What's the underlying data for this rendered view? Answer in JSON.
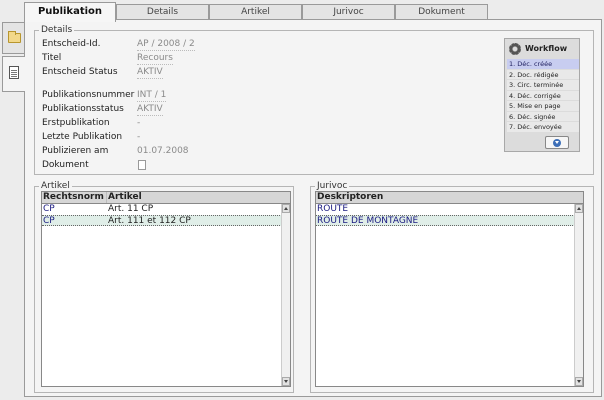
{
  "tabs": [
    {
      "label": "Publikation",
      "active": true
    },
    {
      "label": "Details",
      "active": false
    },
    {
      "label": "Artikel",
      "active": false
    },
    {
      "label": "Jurivoc",
      "active": false
    },
    {
      "label": "Dokument",
      "active": false
    }
  ],
  "details": {
    "legend": "Details",
    "fields": [
      {
        "label": "Entscheid-Id.",
        "value": "AP / 2008 / 2"
      },
      {
        "label": "Titel",
        "value": "Recours"
      },
      {
        "label": "Entscheid Status",
        "value": "AKTIV"
      },
      {
        "label": "Publikationsnummer",
        "value": "INT / 1"
      },
      {
        "label": "Publikationsstatus",
        "value": "AKTIV"
      },
      {
        "label": "Erstpublikation",
        "value": "-"
      },
      {
        "label": "Letzte Publikation",
        "value": "-"
      },
      {
        "label": "Publizieren am",
        "value": "01.07.2008"
      },
      {
        "label": "Dokument",
        "value": ""
      }
    ]
  },
  "workflow": {
    "title": "Workflow",
    "items": [
      "1. Déc. créée",
      "2. Doc. rédigée",
      "3. Circ. terminée",
      "4. Déc. corrigée",
      "5. Mise en page",
      "6. Déc. signée",
      "7. Déc. envoyée"
    ]
  },
  "artikel": {
    "legend": "Artikel",
    "headers": [
      "Rechtsnorm",
      "Artikel"
    ],
    "rows": [
      [
        "CP",
        "Art. 11 CP"
      ],
      [
        "CP",
        "Art. 111 et 112 CP"
      ]
    ]
  },
  "jurivoc": {
    "legend": "Jurivoc",
    "headers": [
      "Deskriptoren"
    ],
    "rows": [
      [
        "ROUTE"
      ],
      [
        "ROUTE DE MONTAGNE"
      ]
    ]
  },
  "colors": {
    "accent": "#c8cdf0",
    "selected_row": "#e0eee8",
    "text_link": "#1a1a80"
  }
}
